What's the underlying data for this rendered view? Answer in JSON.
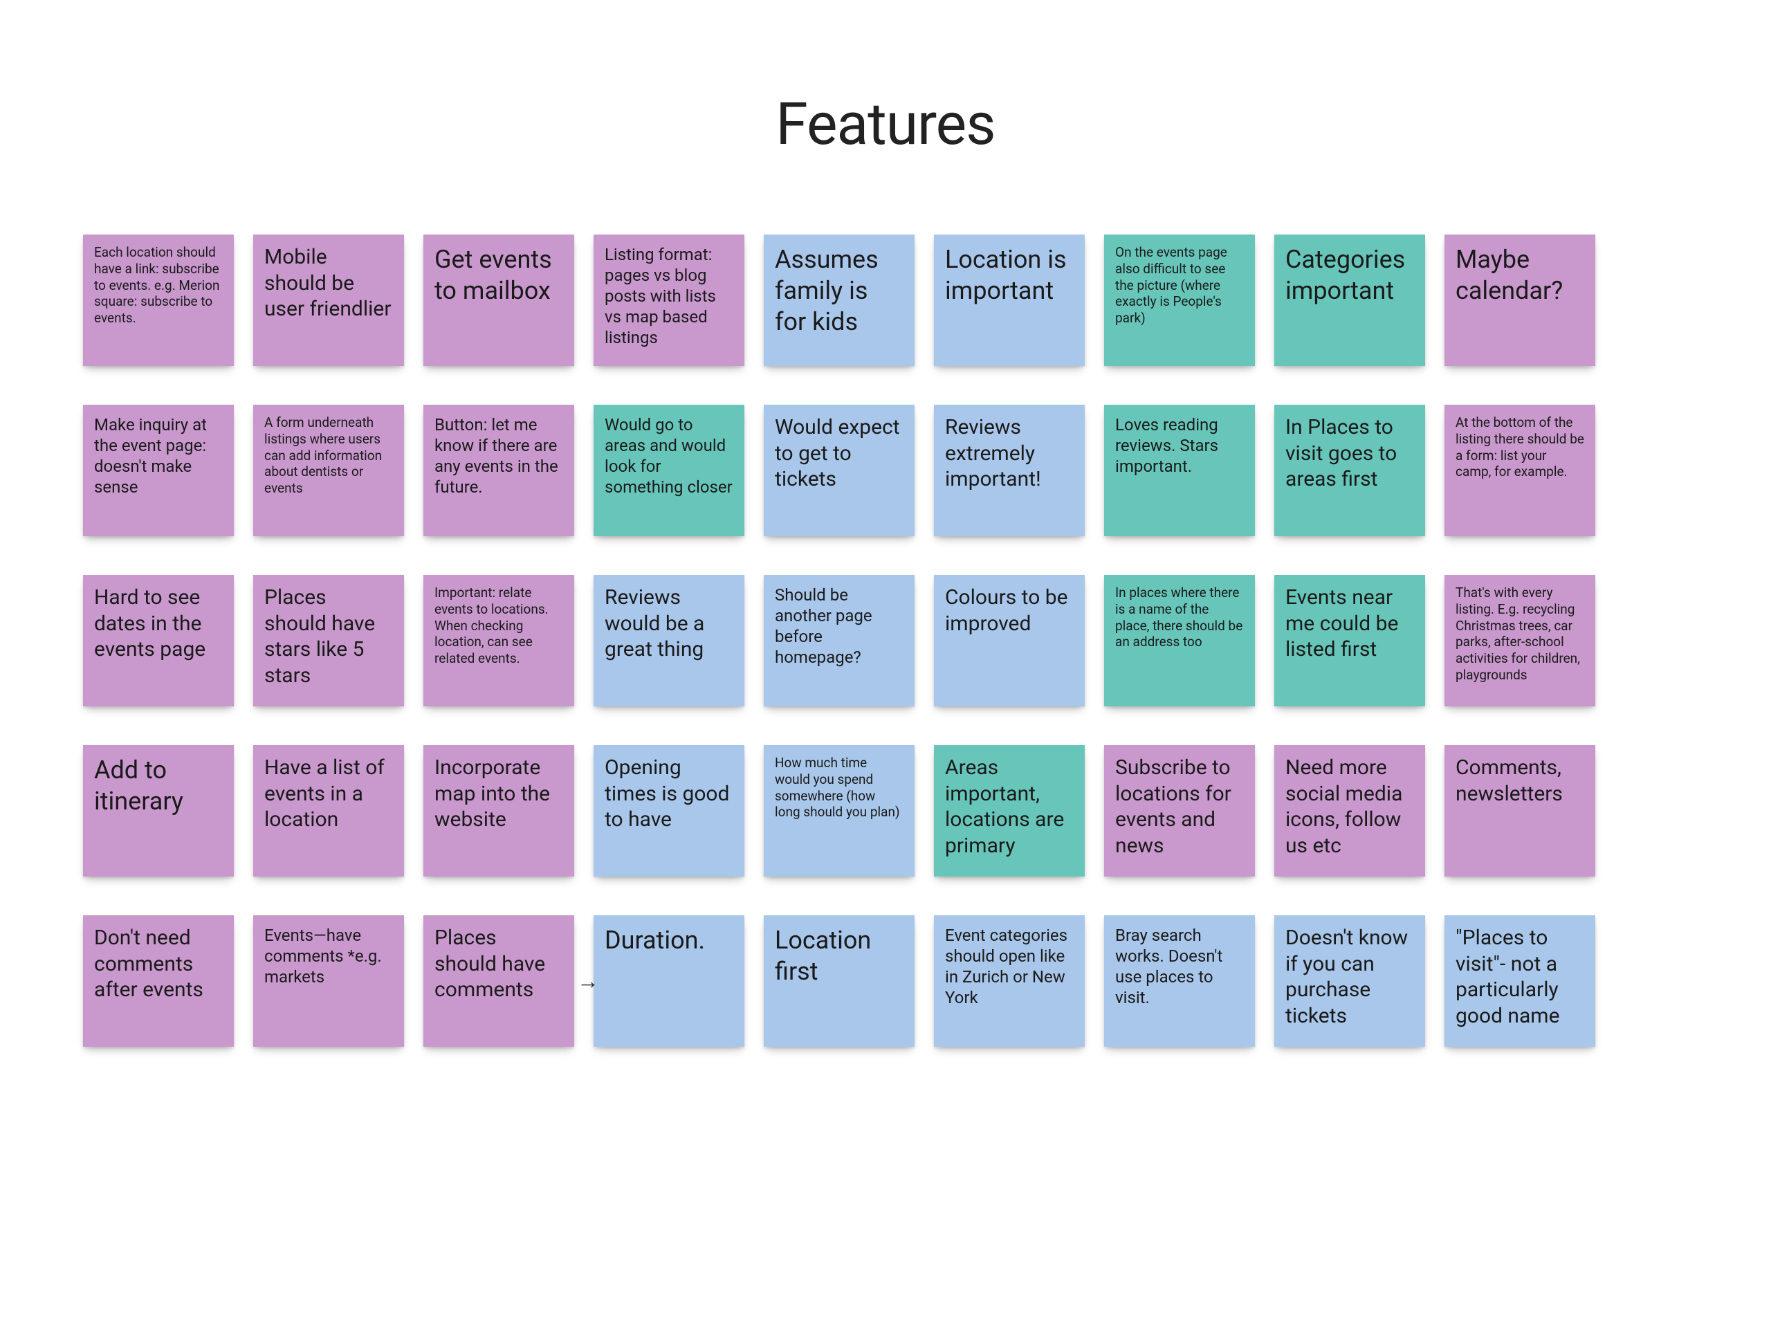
{
  "title": "Features",
  "rows": [
    [
      {
        "text": "Each location should have a link: subscribe to events. e.g. Merion square: subscribe to events.",
        "color": "purple",
        "size": "xs"
      },
      {
        "text": "Mobile should be user friendlier",
        "color": "purple",
        "size": "md"
      },
      {
        "text": "Get events to mailbox",
        "color": "purple",
        "size": "lg"
      },
      {
        "text": "Listing format: pages vs blog posts with lists vs map based listings",
        "color": "purple",
        "size": "sm"
      },
      {
        "text": "Assumes family is for kids",
        "color": "blue",
        "size": "lg"
      },
      {
        "text": "Location is important",
        "color": "blue",
        "size": "lg"
      },
      {
        "text": "On the events page also difficult to see the picture (where exactly is People's park)",
        "color": "teal",
        "size": "xs"
      },
      {
        "text": "Categories important",
        "color": "teal",
        "size": "lg"
      },
      {
        "text": "Maybe calendar?",
        "color": "purple",
        "size": "lg"
      }
    ],
    [
      {
        "text": "Make inquiry at the event page: doesn't make sense",
        "color": "purple",
        "size": "sm"
      },
      {
        "text": "A form underneath listings where users can add information about dentists or events",
        "color": "purple",
        "size": "xs"
      },
      {
        "text": "Button: let me know if there are any events in the future.",
        "color": "purple",
        "size": "sm"
      },
      {
        "text": "Would go to areas and would look for something closer",
        "color": "teal",
        "size": "sm"
      },
      {
        "text": "Would expect to get to tickets",
        "color": "blue",
        "size": "md"
      },
      {
        "text": "Reviews extremely important!",
        "color": "blue",
        "size": "md"
      },
      {
        "text": "Loves reading reviews. Stars important.",
        "color": "teal",
        "size": "sm"
      },
      {
        "text": "In Places to visit goes to areas first",
        "color": "teal",
        "size": "md"
      },
      {
        "text": "At the bottom of the listing there should be a form: list your camp, for example.",
        "color": "purple",
        "size": "xs"
      }
    ],
    [
      {
        "text": "Hard to see dates in the events page",
        "color": "purple",
        "size": "md"
      },
      {
        "text": "Places should have stars like 5 stars",
        "color": "purple",
        "size": "md"
      },
      {
        "text": "Important: relate events to locations. When checking location, can see related events.",
        "color": "purple",
        "size": "xs"
      },
      {
        "text": "Reviews would be a great thing",
        "color": "blue",
        "size": "md"
      },
      {
        "text": "Should be another page before homepage?",
        "color": "blue",
        "size": "sm"
      },
      {
        "text": "Colours to be improved",
        "color": "blue",
        "size": "md"
      },
      {
        "text": "In places where there is a name of the place, there should be an address too",
        "color": "teal",
        "size": "xs"
      },
      {
        "text": "Events near me could be listed first",
        "color": "teal",
        "size": "md"
      },
      {
        "text": "That's with every listing. E.g. recycling Christmas trees, car parks, after-school activities for children, playgrounds",
        "color": "purple",
        "size": "xs"
      }
    ],
    [
      {
        "text": "Add to itinerary",
        "color": "purple",
        "size": "lg"
      },
      {
        "text": "Have a list of events in a location",
        "color": "purple",
        "size": "md"
      },
      {
        "text": "Incorporate map into the website",
        "color": "purple",
        "size": "md"
      },
      {
        "text": "Opening times is good to have",
        "color": "blue",
        "size": "md"
      },
      {
        "text": "How much time would you spend somewhere (how long should you plan)",
        "color": "blue",
        "size": "xs"
      },
      {
        "text": "Areas important, locations are primary",
        "color": "teal",
        "size": "md"
      },
      {
        "text": "Subscribe to locations for events and news",
        "color": "purple",
        "size": "md"
      },
      {
        "text": "Need more social media icons, follow us etc",
        "color": "purple",
        "size": "md"
      },
      {
        "text": "Comments, newsletters",
        "color": "purple",
        "size": "md"
      }
    ],
    [
      {
        "text": "Don't need comments after events",
        "color": "purple",
        "size": "md"
      },
      {
        "text": "Events—have comments *e.g. markets",
        "color": "purple",
        "size": "sm"
      },
      {
        "text": "Places should have comments",
        "color": "purple",
        "size": "md"
      },
      {
        "text": "Duration.",
        "color": "blue",
        "size": "lg",
        "arrow": true
      },
      {
        "text": "Location first",
        "color": "blue",
        "size": "lg"
      },
      {
        "text": "Event categories should open like in Zurich or New York",
        "color": "blue",
        "size": "sm"
      },
      {
        "text": "Bray search works. Doesn't use places to visit.",
        "color": "blue",
        "size": "sm"
      },
      {
        "text": "Doesn't know if you can purchase tickets",
        "color": "blue",
        "size": "md"
      },
      {
        "text": "\"Places to visit\"- not a particularly good name",
        "color": "blue",
        "size": "md"
      }
    ]
  ]
}
